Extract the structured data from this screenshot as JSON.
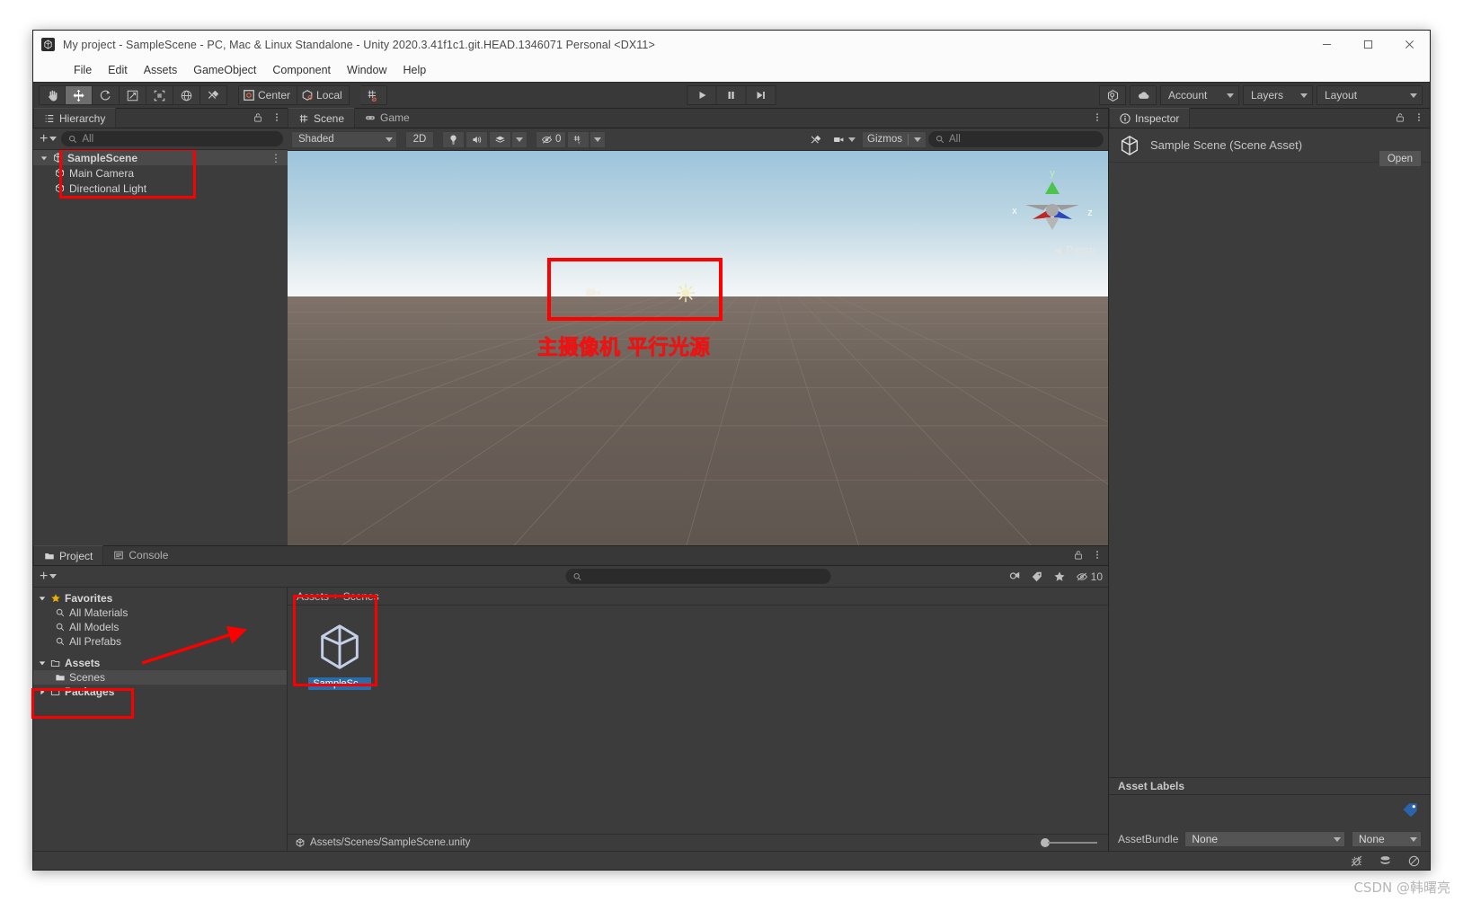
{
  "window": {
    "title": "My project - SampleScene - PC, Mac & Linux Standalone - Unity 2020.3.41f1c1.git.HEAD.1346071 Personal <DX11>",
    "icon": "unity-icon",
    "controls": {
      "minimize": "minimize-icon",
      "maximize": "maximize-icon",
      "close": "close-icon"
    }
  },
  "menubar": {
    "items": [
      {
        "label": "File"
      },
      {
        "label": "Edit"
      },
      {
        "label": "Assets"
      },
      {
        "label": "GameObject"
      },
      {
        "label": "Component"
      },
      {
        "label": "Window"
      },
      {
        "label": "Help"
      }
    ]
  },
  "toolbar": {
    "tools": [
      {
        "name": "hand-tool-icon",
        "active": false
      },
      {
        "name": "move-tool-icon",
        "active": true
      },
      {
        "name": "rotate-tool-icon",
        "active": false
      },
      {
        "name": "scale-tool-icon",
        "active": false
      },
      {
        "name": "rect-tool-icon",
        "active": false
      },
      {
        "name": "transform-tool-icon",
        "active": false
      },
      {
        "name": "custom-tool-icon",
        "active": false
      }
    ],
    "pivot_label": "Center",
    "rotation_label": "Local",
    "grid_snap_icon": "grid-snap-icon",
    "play_label": "play-icon",
    "pause_label": "pause-icon",
    "step_label": "step-icon",
    "collab_icon": "collab-icon",
    "cloud_icon": "cloud-icon",
    "account_label": "Account",
    "layers_label": "Layers",
    "layout_label": "Layout"
  },
  "hierarchy": {
    "tab_label": "Hierarchy",
    "tab_icon": "hierarchy-icon",
    "lock_icon": "lock-icon",
    "menu_icon": "kebab-icon",
    "add_label": "+",
    "search_placeholder": "All",
    "rows": [
      {
        "label": "SampleScene",
        "icon": "scene-icon",
        "depth": 0,
        "expanded": true,
        "selected": true,
        "kebab": true
      },
      {
        "label": "Main Camera",
        "icon": "gameobject-icon",
        "depth": 1,
        "expanded": false,
        "selected": false,
        "kebab": false
      },
      {
        "label": "Directional Light",
        "icon": "gameobject-icon",
        "depth": 1,
        "expanded": false,
        "selected": false,
        "kebab": false
      }
    ]
  },
  "scene": {
    "tabs": [
      {
        "label": "Scene",
        "icon": "scene-tab-icon",
        "active": true
      },
      {
        "label": "Game",
        "icon": "game-tab-icon",
        "active": false
      }
    ],
    "menu_icon": "kebab-icon",
    "draw_mode": "Shaded",
    "toggle_2d": "2D",
    "light_icon": "lighting-icon",
    "audio_icon": "audio-icon",
    "fx_icon": "effects-icon",
    "hidden_count": "0",
    "hidden_icon": "hidden-objects-icon",
    "grid_icon": "scene-grid-icon",
    "tools_icon": "scene-tools-icon",
    "camera_icon": "scene-camera-icon",
    "gizmos_label": "Gizmos",
    "search_placeholder": "All",
    "gizmo_axes": {
      "x": "x",
      "y": "y",
      "z": "z"
    },
    "projection_label": "Persp",
    "annotation": "主摄像机 平行光源",
    "objects": [
      {
        "name": "main-camera-gizmo"
      },
      {
        "name": "directional-light-gizmo"
      }
    ]
  },
  "project": {
    "tabs": [
      {
        "label": "Project",
        "icon": "project-icon",
        "active": true
      },
      {
        "label": "Console",
        "icon": "console-icon",
        "active": false
      }
    ],
    "lock_icon": "lock-icon",
    "menu_icon": "kebab-icon",
    "add_label": "+",
    "search_placeholder": "",
    "filter_icons": [
      {
        "name": "search-filter-icon"
      },
      {
        "name": "label-filter-icon"
      },
      {
        "name": "favorite-star-icon"
      },
      {
        "name": "hidden-packages-icon"
      }
    ],
    "hidden_packages_count": "10",
    "tree": [
      {
        "label": "Favorites",
        "icon": "star-icon",
        "depth": 0,
        "expanded": true,
        "bold": true,
        "highlight": false
      },
      {
        "label": "All Materials",
        "icon": "search-small-icon",
        "depth": 1,
        "expanded": null,
        "bold": false,
        "highlight": false
      },
      {
        "label": "All Models",
        "icon": "search-small-icon",
        "depth": 1,
        "expanded": null,
        "bold": false,
        "highlight": false
      },
      {
        "label": "All Prefabs",
        "icon": "search-small-icon",
        "depth": 1,
        "expanded": null,
        "bold": false,
        "highlight": false
      },
      {
        "label": "Assets",
        "icon": "folder-open-icon",
        "depth": 0,
        "expanded": true,
        "bold": true,
        "highlight": false
      },
      {
        "label": "Scenes",
        "icon": "folder-icon",
        "depth": 1,
        "expanded": null,
        "bold": false,
        "highlight": true
      },
      {
        "label": "Packages",
        "icon": "folder-open-icon",
        "depth": 0,
        "expanded": false,
        "bold": true,
        "highlight": false
      }
    ],
    "breadcrumb": [
      "Assets",
      "Scenes"
    ],
    "breadcrumb_sep": "›",
    "assets": [
      {
        "label": "SampleSc...",
        "icon": "unity-scene-asset-icon",
        "selected": true
      }
    ],
    "status_path": "Assets/Scenes/SampleScene.unity",
    "status_icon": "unity-scene-asset-icon",
    "zoom_value": "90"
  },
  "inspector": {
    "tab_label": "Inspector",
    "tab_icon": "info-icon",
    "lock_icon": "lock-icon",
    "menu_icon": "kebab-icon",
    "asset_title": "Sample Scene (Scene Asset)",
    "asset_icon": "unity-scene-asset-icon",
    "open_label": "Open",
    "asset_labels_header": "Asset Labels",
    "tag_icon": "label-tag-icon",
    "assetbundle_label": "AssetBundle",
    "assetbundle_value": "None",
    "assetbundle_variant": "None"
  },
  "statusbar": {
    "icons": [
      {
        "name": "bug-muted-icon"
      },
      {
        "name": "layers-stack-icon"
      },
      {
        "name": "disabled-circle-icon"
      }
    ]
  },
  "watermark": "CSDN @韩曙亮",
  "colors": {
    "accent_red": "#fa0000",
    "selection_blue": "#2b6ca8",
    "panel_bg": "#3c3c3c",
    "window_bg": "#383838"
  }
}
